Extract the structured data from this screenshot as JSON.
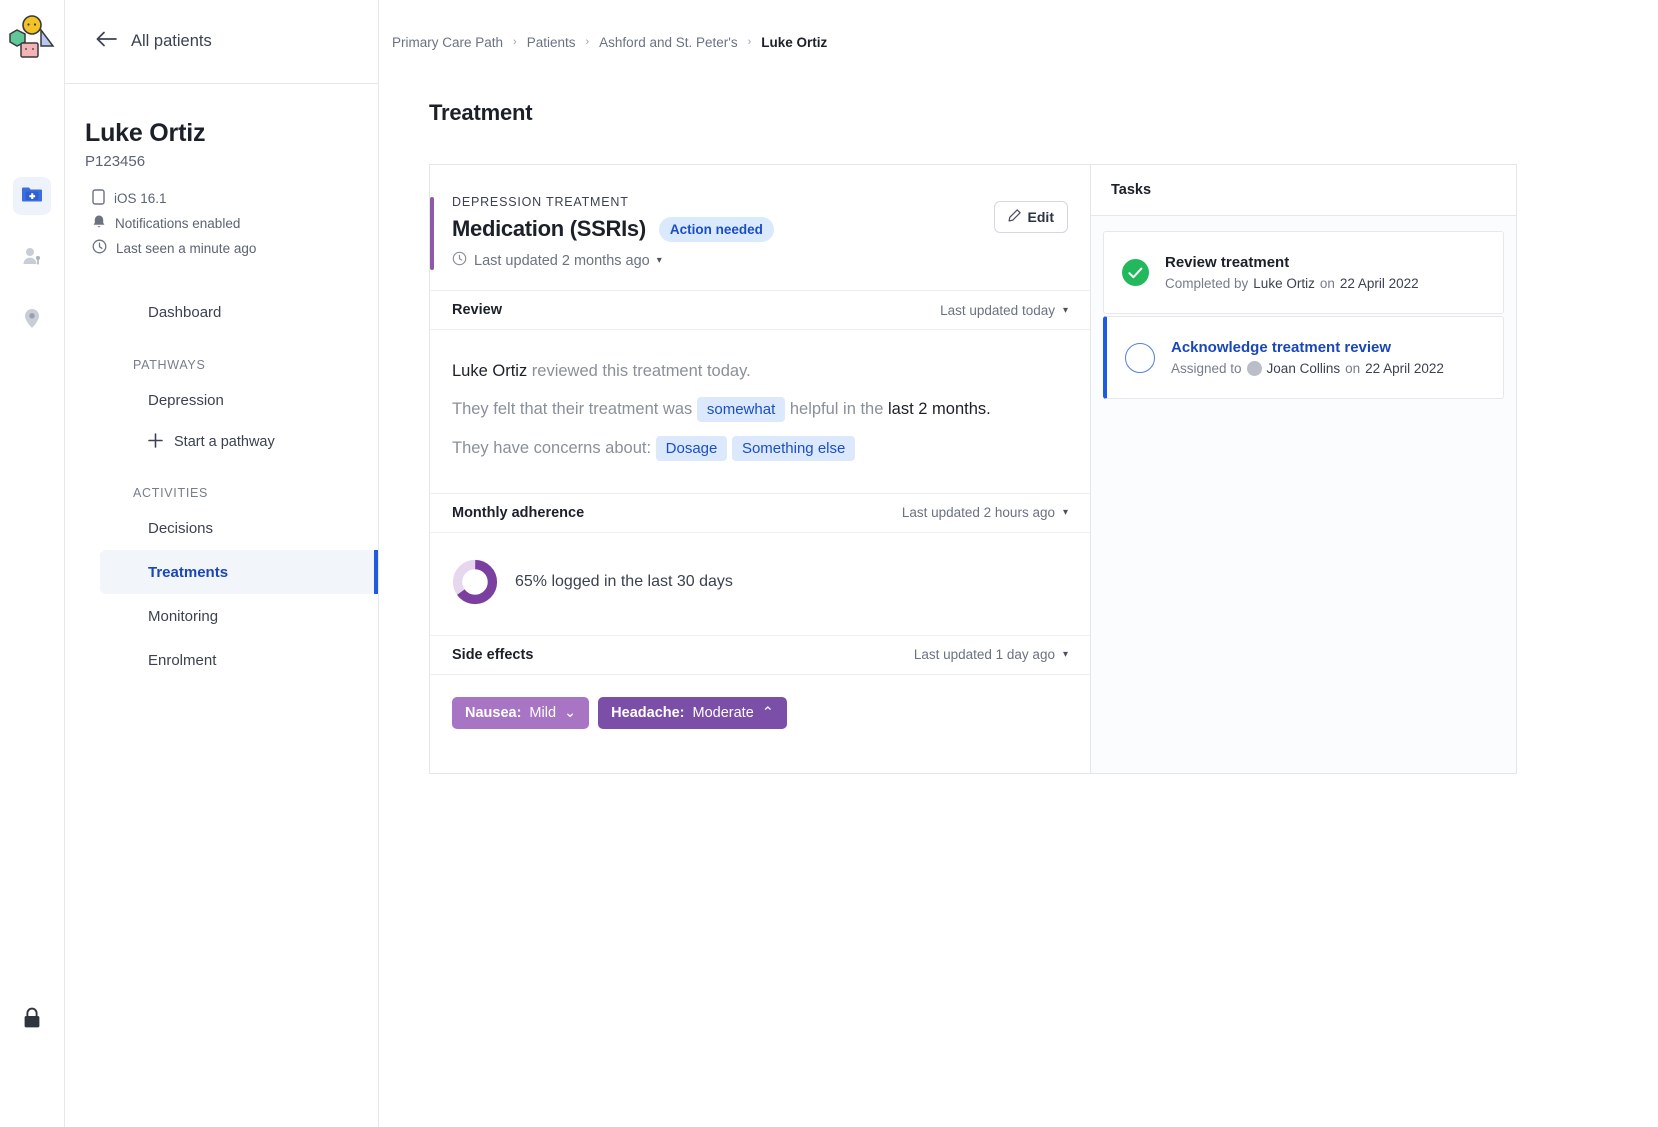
{
  "rail": {
    "logo_name": "app-logo",
    "items": [
      {
        "name": "patient-records-icon",
        "label": "Patient records",
        "active": true
      },
      {
        "name": "clinicians-icon",
        "label": "Clinicians",
        "active": false
      },
      {
        "name": "location-pin-icon",
        "label": "Locations",
        "active": false
      }
    ],
    "lock_label": "Lock"
  },
  "sidebar": {
    "back_label": "All patients",
    "patient": {
      "name": "Luke Ortiz",
      "id": "P123456",
      "meta": [
        {
          "icon": "phone-icon",
          "text": "iOS 16.1"
        },
        {
          "icon": "bell-icon",
          "text": "Notifications enabled"
        },
        {
          "icon": "clock-icon",
          "text": "Last seen a minute ago"
        }
      ]
    },
    "nav": {
      "dashboard": "Dashboard",
      "pathways_group": "PATHWAYS",
      "pathways": [
        "Depression"
      ],
      "start_pathway": "Start a pathway",
      "activities_group": "ACTIVITIES",
      "activities": [
        "Decisions",
        "Treatments",
        "Monitoring",
        "Enrolment"
      ],
      "selected": "Treatments"
    }
  },
  "breadcrumb": {
    "items": [
      {
        "label": "Primary Care Path",
        "current": false
      },
      {
        "label": "Patients",
        "current": false
      },
      {
        "label": "Ashford and St. Peter's",
        "current": false
      },
      {
        "label": "Luke Ortiz",
        "current": true
      }
    ],
    "separator": "›"
  },
  "page": {
    "title": "Treatment"
  },
  "treatment": {
    "kicker": "DEPRESSION TREATMENT",
    "title": "Medication (SSRIs)",
    "status_badge": "Action needed",
    "last_updated": "Last updated 2 months ago",
    "edit_label": "Edit",
    "review": {
      "heading": "Review",
      "meta": "Last updated today",
      "line1_name": "Luke Ortiz",
      "line1_rest": "reviewed this treatment today.",
      "line2_a": "They felt that their treatment was",
      "line2_chip": "somewhat",
      "line2_b": "helpful in the",
      "line2_strong": "last 2 months.",
      "line3_a": "They have concerns about:",
      "line3_chips": [
        "Dosage",
        "Something else"
      ]
    },
    "adherence": {
      "heading": "Monthly adherence",
      "meta": "Last updated 2 hours ago",
      "percent": 65,
      "text": "65% logged in the last 30 days",
      "ring_color": "#7b3fa0",
      "track_color": "#e6d7ef"
    },
    "side_effects": {
      "heading": "Side effects",
      "meta": "Last updated 1 day ago",
      "items": [
        {
          "label": "Nausea:",
          "value": "Mild",
          "chevron": "⌄",
          "severity": "mild"
        },
        {
          "label": "Headache:",
          "value": "Moderate",
          "chevron": "⌃",
          "severity": "moderate"
        }
      ]
    }
  },
  "tasks": {
    "title": "Tasks",
    "items": [
      {
        "name": "Review treatment",
        "state": "completed",
        "prefix": "Completed by",
        "person": "Luke Ortiz",
        "mid": "on",
        "date": "22 April 2022",
        "has_avatar": false
      },
      {
        "name": "Acknowledge treatment review",
        "state": "open",
        "prefix": "Assigned to",
        "person": "Joan Collins",
        "mid": "on",
        "date": "22 April 2022",
        "has_avatar": true
      }
    ]
  },
  "colors": {
    "accent_blue": "#1f5be0",
    "link_blue": "#1a47b8",
    "treatment_accent": "#8e5aa8",
    "done_green": "#21b95b"
  }
}
